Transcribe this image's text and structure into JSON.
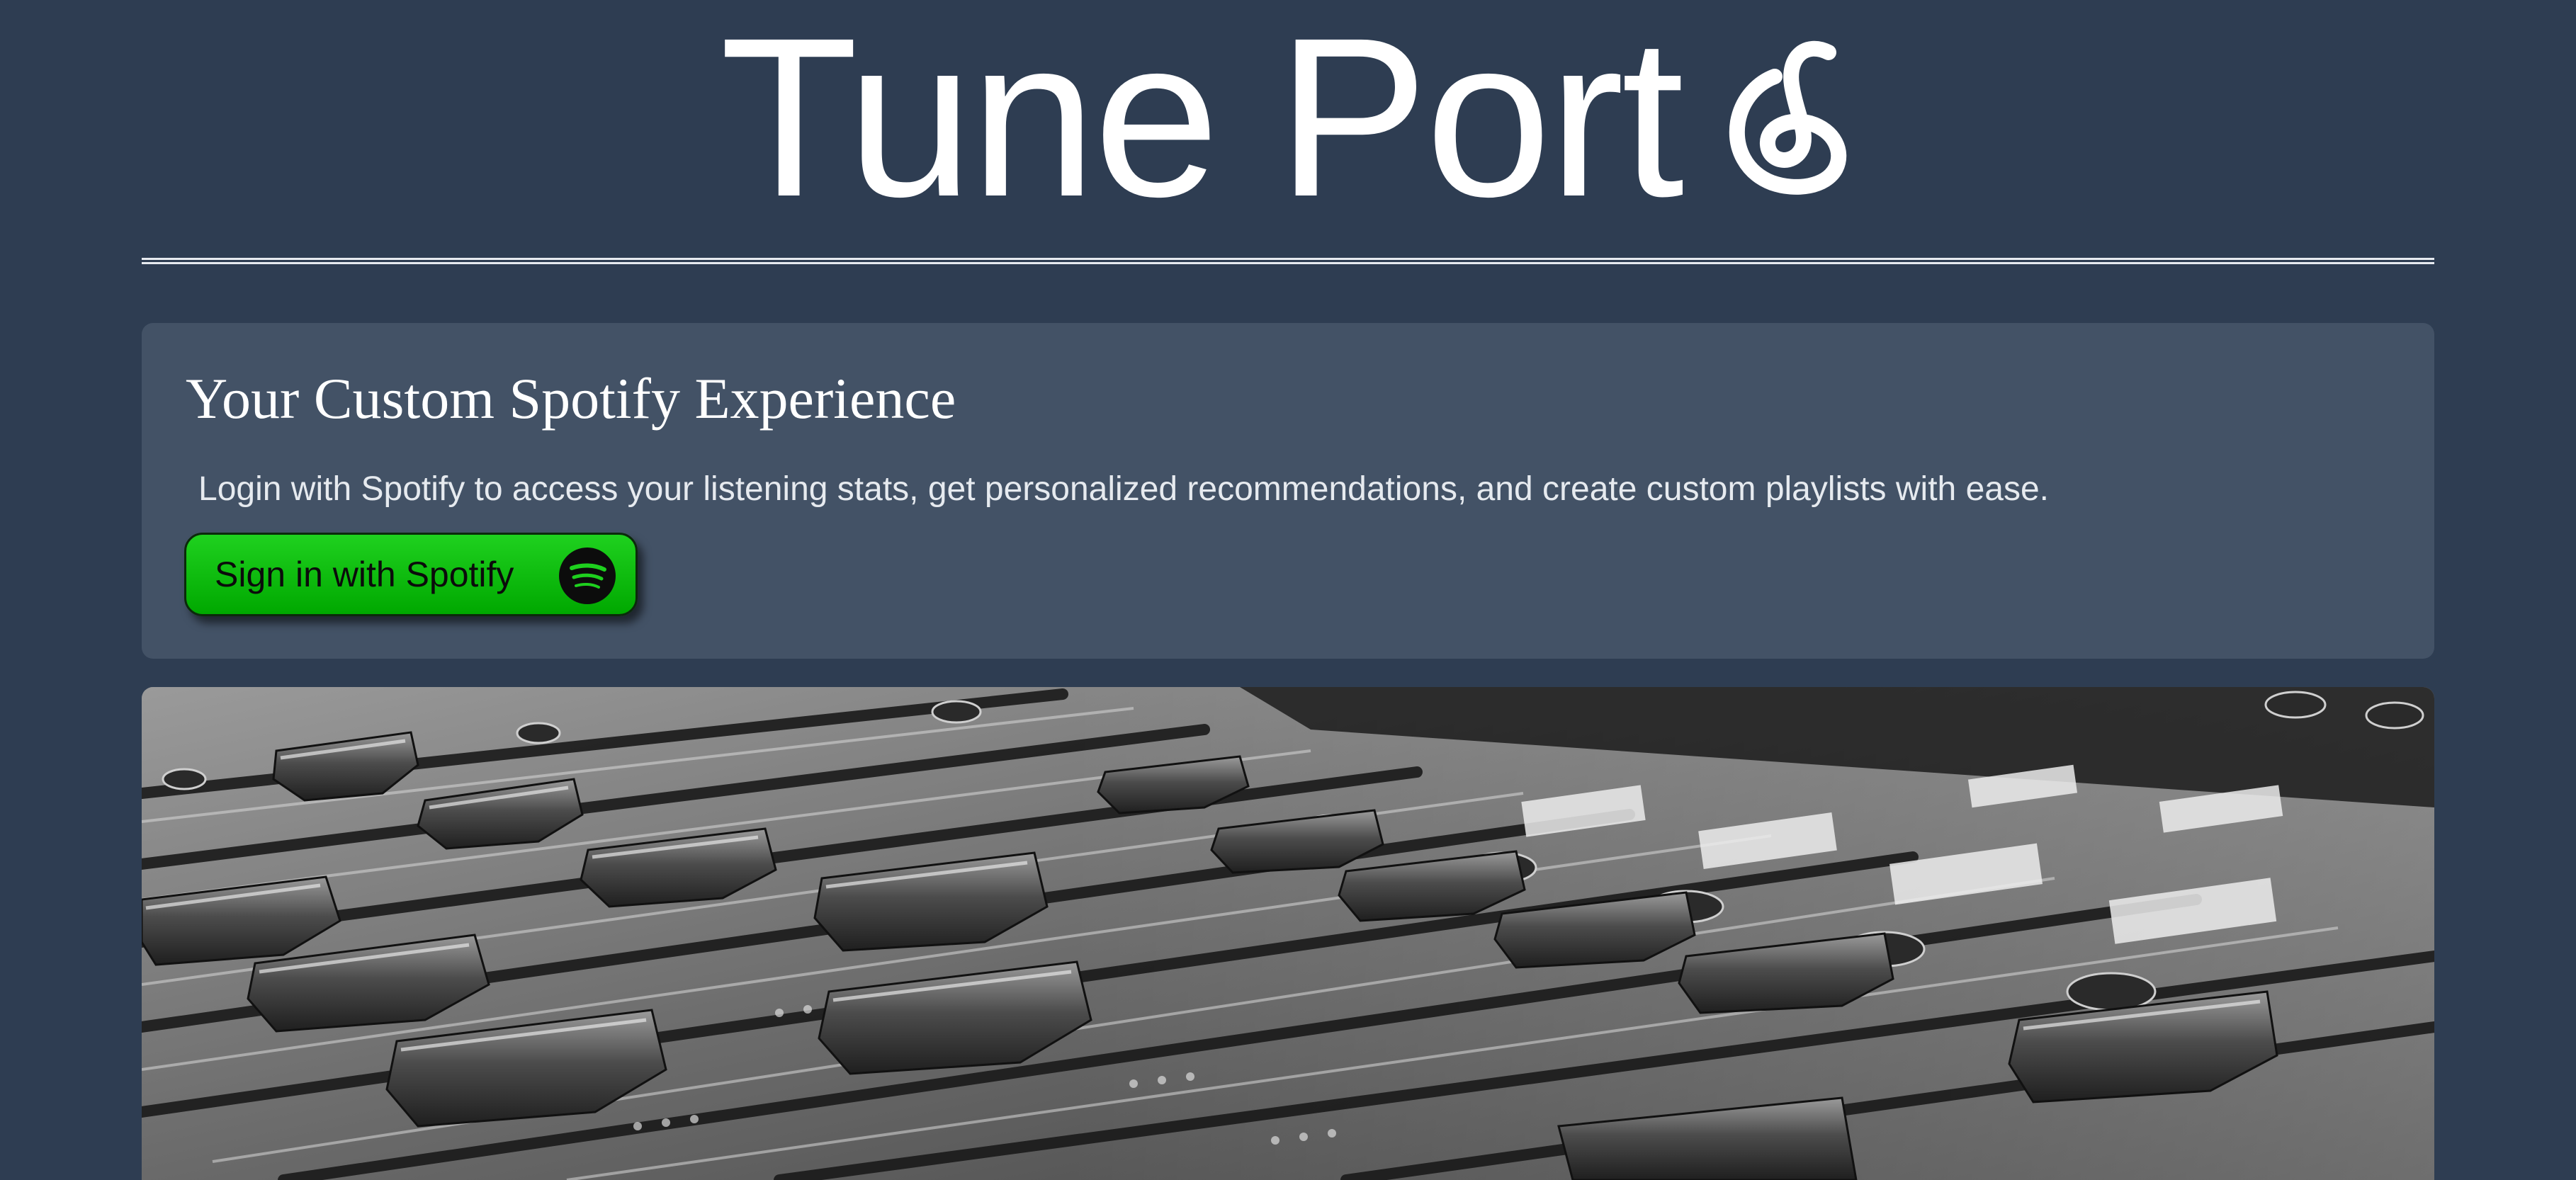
{
  "header": {
    "title": "Tune Port",
    "logo_icon": "music-note-loop-icon"
  },
  "intro": {
    "heading": "Your Custom Spotify Experience",
    "description": "Login with Spotify to access your listening stats, get personalized recommendations, and create custom playlists with ease.",
    "signin_label": "Sign in with Spotify",
    "signin_icon": "spotify-icon"
  },
  "hero": {
    "image_subject": "audio-mixing-console-photo"
  },
  "colors": {
    "background": "#2e3d52",
    "card": "#435266",
    "button_green": "#1ed01e"
  }
}
